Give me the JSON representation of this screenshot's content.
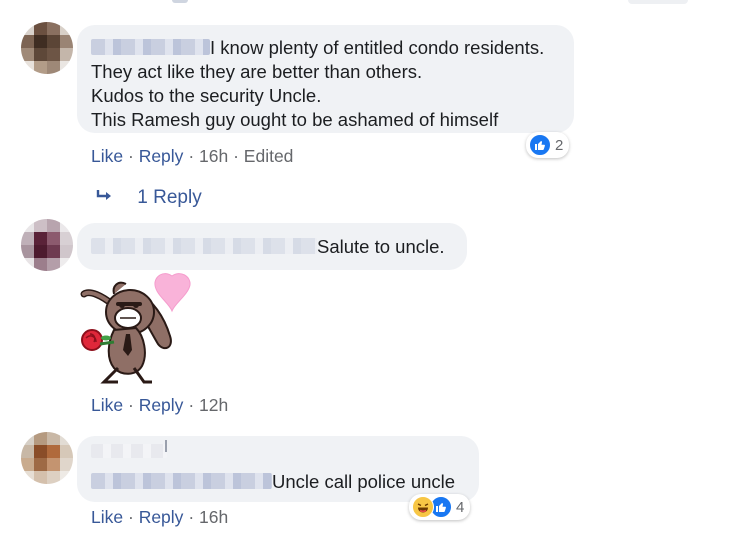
{
  "comments": [
    {
      "text_lines": [
        "I know plenty of entitled condo residents.",
        "They act like they are better than others.",
        "Kudos to the security Uncle.",
        "This Ramesh guy ought to be ashamed of himself"
      ],
      "actions": {
        "like": "Like",
        "reply": "Reply",
        "time": "16h",
        "edited": "Edited"
      },
      "reactions": {
        "count": "2",
        "types": [
          "like"
        ]
      },
      "replies_link": "1 Reply"
    },
    {
      "text": "Salute to uncle.",
      "sticker": "bunny-rose-heart-sticker",
      "actions": {
        "like": "Like",
        "reply": "Reply",
        "time": "12h"
      }
    },
    {
      "text": "Uncle call police uncle",
      "actions": {
        "like": "Like",
        "reply": "Reply",
        "time": "16h"
      },
      "reactions": {
        "count": "4",
        "types": [
          "haha",
          "like"
        ]
      }
    }
  ],
  "separator": "·",
  "colors": {
    "link": "#385898",
    "meta": "#65676b",
    "bubble": "#f0f2f5",
    "like": "#1877f2",
    "haha": "#f7c645"
  }
}
